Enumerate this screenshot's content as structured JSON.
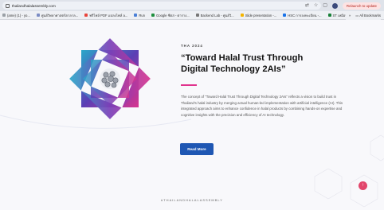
{
  "browser": {
    "url": "thailandhalalassembly.com",
    "update_label": "Relaunch to update",
    "bookmarks": [
      {
        "label": "(ame) (1) - yo...",
        "color": "#9aa0a6"
      },
      {
        "label": "ศูนย์วิทยาศาสตร์ฮาลาล...",
        "color": "#7b8cc4"
      },
      {
        "label": "ฟรีไฟล์ PDF แปลงไฟล์ a...",
        "color": "#e8453c"
      },
      {
        "label": "Run",
        "color": "#4a7fd6"
      },
      {
        "label": "Google ชีตส - ตาราง...",
        "color": "#1e8e3e"
      },
      {
        "label": "Backend Lab - ศูนย์วิ...",
        "color": "#777777"
      },
      {
        "label": "Slide presentation -...",
        "color": "#f4b400"
      },
      {
        "label": "HSC การลงทะเบียน -...",
        "color": "#1a73e8"
      },
      {
        "label": "ST เหมือนวิเคราะห์ - Excel ศูน...",
        "color": "#188038"
      }
    ],
    "all_bookmarks_label": "All Bookmarks"
  },
  "hero": {
    "eyebrow": "THA 2024",
    "title": "“Toward Halal Trust Through Digital Technology 2AIs”",
    "body": "The concept of “Toward Halal Trust Through Digital Technology 2AIs” reflects a vision to build trust in Thailand's halal industry by merging actual human-led implementation with artificial intelligence (AI). This integrated approach aims to enhance confidence in halal products by combining hands-on expertise and cognitive insights with the precision and efficiency of AI technology.",
    "button_label": "Read More"
  },
  "footer": {
    "hashtag": "#THAILANDHALALASSEMBLY"
  },
  "colors": {
    "accent": "#e0338d",
    "button": "#1f57b3",
    "scroll_top": "#e2456b"
  }
}
